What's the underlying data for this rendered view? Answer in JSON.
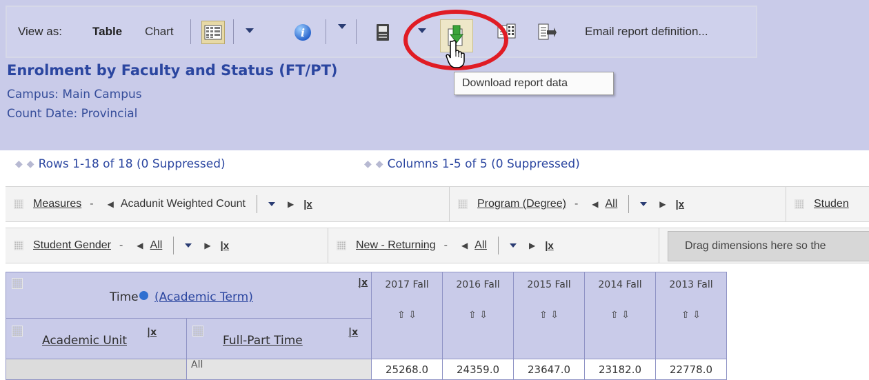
{
  "toolbar": {
    "view_as_label": "View as:",
    "view_table": "Table",
    "view_chart": "Chart",
    "email_report": "Email report definition..."
  },
  "report": {
    "title": "Enrolment by Faculty and Status (FT/PT)",
    "campus": "Campus: Main Campus",
    "count_date": "Count Date: Provincial"
  },
  "tooltip": "Download report data",
  "paging": {
    "rows": "Rows 1-18 of 18  (0 Suppressed)",
    "columns": "Columns 1-5 of 5  (0 Suppressed)"
  },
  "dimensions_row1": [
    {
      "name": "Measures",
      "value": "Acadunit Weighted Count",
      "value_link": false
    },
    {
      "name": "Program (Degree)",
      "value": "All",
      "value_link": true
    },
    {
      "name": "Studen",
      "value": "",
      "value_link": false
    }
  ],
  "dimensions_row2": [
    {
      "name": "Student Gender",
      "value": "All",
      "value_link": true
    },
    {
      "name": "New - Returning",
      "value": "All",
      "value_link": true
    }
  ],
  "drop_zone_text": "Drag dimensions here so the",
  "table": {
    "time_label": "Time",
    "time_link": "(Academic Term)",
    "row_dim1": "Academic Unit",
    "row_dim2": "Full-Part Time",
    "close_mark": "x",
    "columns": [
      "2017 Fall",
      "2016 Fall",
      "2015 Fall",
      "2014 Fall",
      "2013 Fall"
    ],
    "sort_glyph": "⇧ ⇩",
    "rows": [
      {
        "unit": "",
        "status": "All",
        "values": [
          "25268.0",
          "24359.0",
          "23647.0",
          "23182.0",
          "22778.0"
        ]
      }
    ]
  },
  "colors": {
    "header_band": "#c9cbe9",
    "title_blue": "#2b46a0",
    "highlight_ring": "#e01c24"
  }
}
